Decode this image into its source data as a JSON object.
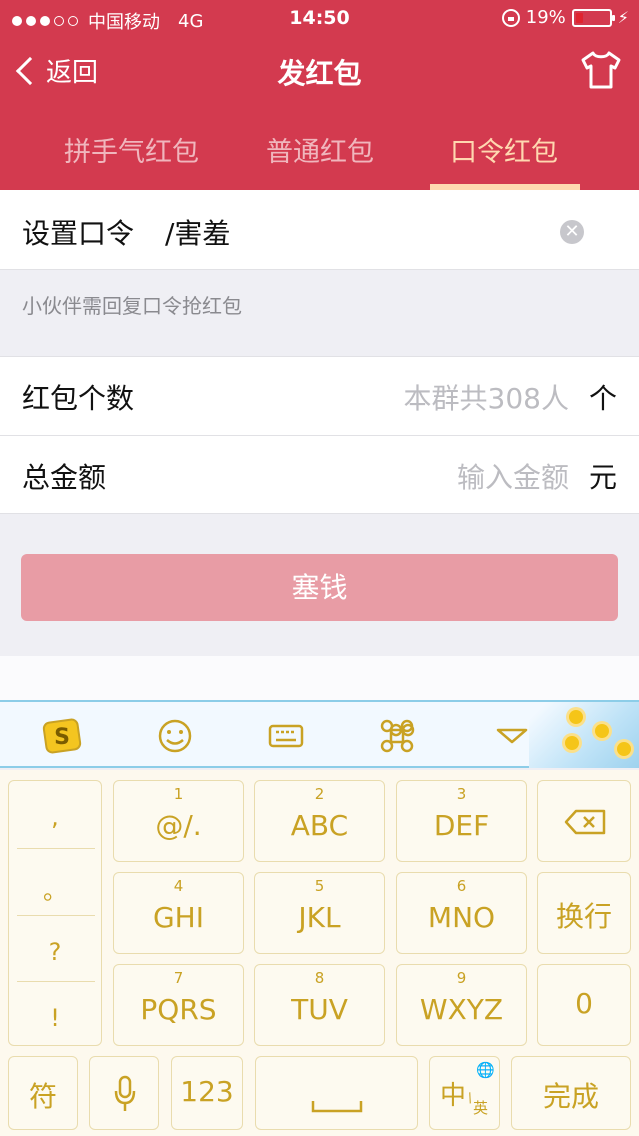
{
  "status": {
    "carrier": "中国移动",
    "network": "4G",
    "time": "14:50",
    "battery": "19%",
    "battery_level": 0.19
  },
  "nav": {
    "back_label": "返回",
    "title": "发红包"
  },
  "tabs": [
    {
      "label": "拼手气红包",
      "active": false
    },
    {
      "label": "普通红包",
      "active": false
    },
    {
      "label": "口令红包",
      "active": true
    }
  ],
  "form": {
    "password_label": "设置口令",
    "password_value": "/害羞",
    "hint": "小伙伴需回复口令抢红包",
    "count_label": "红包个数",
    "count_placeholder": "本群共308人",
    "count_unit": "个",
    "amount_label": "总金额",
    "amount_placeholder": "输入金额",
    "amount_unit": "元",
    "submit_label": "塞钱"
  },
  "keyboard": {
    "punct": [
      ",",
      "。",
      "?",
      "!"
    ],
    "keys_row1": [
      {
        "num": "1",
        "label": "@/."
      },
      {
        "num": "2",
        "label": "ABC"
      },
      {
        "num": "3",
        "label": "DEF"
      }
    ],
    "keys_row2": [
      {
        "num": "4",
        "label": "GHI"
      },
      {
        "num": "5",
        "label": "JKL"
      },
      {
        "num": "6",
        "label": "MNO"
      }
    ],
    "keys_row3": [
      {
        "num": "7",
        "label": "PQRS"
      },
      {
        "num": "8",
        "label": "TUV"
      },
      {
        "num": "9",
        "label": "WXYZ"
      }
    ],
    "newline_label": "换行",
    "zero_label": "0",
    "symbols_label": "符",
    "num_label": "123",
    "lang_main": "中",
    "lang_sub": "英",
    "done_label": "完成"
  },
  "colors": {
    "header": "#d33a4f",
    "tab_active": "#ffd8b0",
    "submit": "#e89ca5",
    "key_text": "#c9a224"
  }
}
